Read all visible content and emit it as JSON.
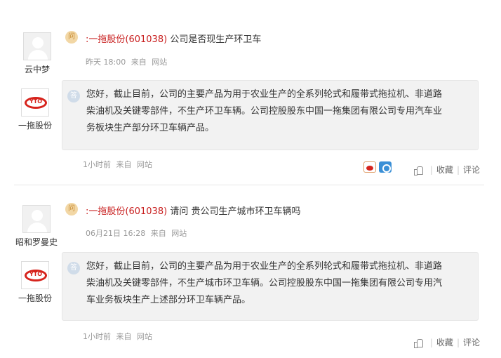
{
  "badges": {
    "question": "问",
    "answer": "答"
  },
  "actions": {
    "like": "",
    "favorite": "收藏",
    "separator": "|",
    "comment": "评论"
  },
  "threads": [
    {
      "asker": "云中梦",
      "company": ":一拖股份",
      "code": "(601038)",
      "question": "公司是否现生产环卫车",
      "q_time": "昨天 18:00",
      "q_source": "来自",
      "q_channel": "网站",
      "answerer": "一拖股份",
      "answer_lines": [
        "您好，截止目前，公司的主要产品为用于农业生产的全系列轮式和履带式拖拉机、非道路",
        "柴油机及关键零部件，不生产环卫车辆。公司控股股东中国一拖集团有限公司专用汽车业",
        "务板块生产部分环卫车辆产品。"
      ],
      "a_time": "1小时前",
      "a_source": "来自",
      "a_channel": "网站",
      "share": [
        "weibo-icon",
        "qzone-icon"
      ]
    },
    {
      "asker": "昭和罗曼史",
      "company": ":一拖股份",
      "code": "(601038)",
      "question": "请问 贵公司生产城市环卫车辆吗",
      "q_time": "06月21日 16:28",
      "q_source": "来自",
      "q_channel": "网站",
      "answerer": "一拖股份",
      "answer_lines": [
        "您好，截止目前，公司的主要产品为用于农业生产的全系列轮式和履带式拖拉机、非道路",
        "柴油机及关键零部件，不生产城市环卫车辆。公司控股股东中国一拖集团有限公司专用汽",
        "车业务板块生产上述部分环卫车辆产品。"
      ],
      "a_time": "1小时前",
      "a_source": "来自",
      "a_channel": "网站"
    }
  ],
  "logo_mark": "YTO"
}
